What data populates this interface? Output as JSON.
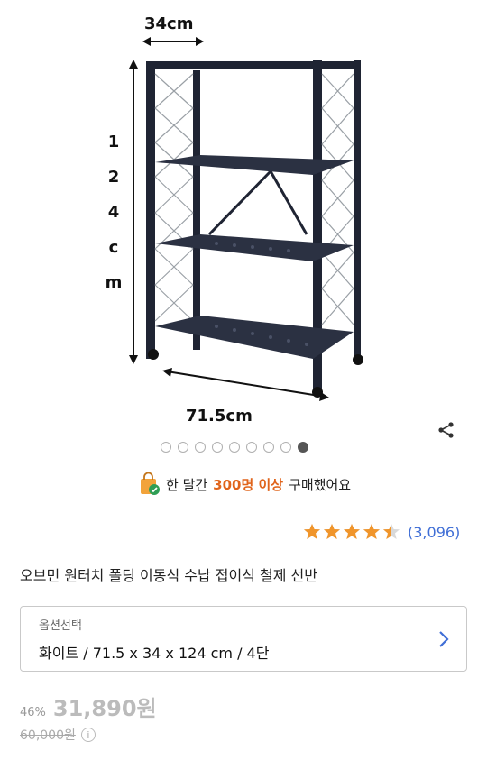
{
  "product_image": {
    "dimension_width": "34cm",
    "dimension_length": "71.5cm",
    "dimension_height_chars": [
      "1",
      "2",
      "4",
      "c",
      "m"
    ]
  },
  "carousel": {
    "total_slides": 9,
    "active_slide": 9
  },
  "buyers_notice": {
    "prefix": "한 달간",
    "highlight": "300명 이상",
    "suffix": "구매했어요"
  },
  "rating": {
    "stars": 4.5,
    "review_count": "(3,096)",
    "star_color": "#f0952b"
  },
  "product": {
    "title": "오브민 원터치 폴딩 이동식 수납 접이식 철제 선반"
  },
  "option": {
    "label": "옵션선택",
    "value": "화이트 / 71.5 x 34 x 124 cm / 4단"
  },
  "pricing": {
    "discount": "46%",
    "price": "31,890원",
    "original_price": "60,000원",
    "info_icon_glyph": "i"
  },
  "colors": {
    "accent": "#e0641b",
    "link": "#3f6ed6"
  }
}
